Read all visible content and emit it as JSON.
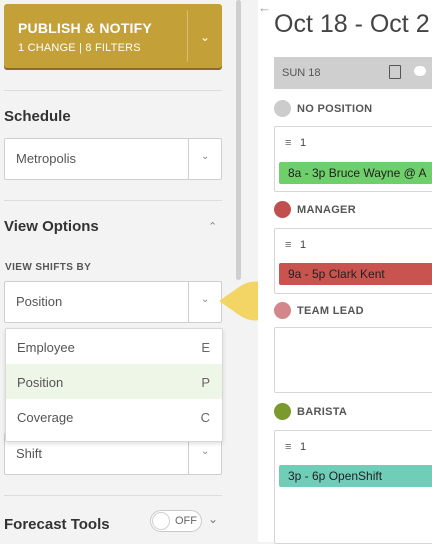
{
  "publish": {
    "title": "PUBLISH & NOTIFY",
    "subtitle": "1 CHANGE | 8 FILTERS",
    "chevron_icon": "chevron-down-icon"
  },
  "schedule": {
    "title": "Schedule",
    "location": "Metropolis"
  },
  "view_options": {
    "title": "View Options",
    "view_shifts_by_label": "VIEW SHIFTS BY",
    "selected": "Position",
    "menu": [
      {
        "label": "Employee",
        "key": "E"
      },
      {
        "label": "Position",
        "key": "P",
        "selected": true
      },
      {
        "label": "Coverage",
        "key": "C"
      }
    ],
    "second_select": "Shift"
  },
  "forecast": {
    "title": "Forecast Tools",
    "toggle_label": "OFF",
    "toggle_on": false
  },
  "calendar": {
    "week_title": "Oct 18 - Oct 2",
    "day_label": "SUN 18",
    "positions": [
      {
        "name": "NO POSITION",
        "color": "#cccccc",
        "count": "1",
        "shift": "8a - 3p  Bruce Wayne @ A",
        "shift_color": "#6fcf6a"
      },
      {
        "name": "MANAGER",
        "color": "#c0504d",
        "count": "1",
        "shift": "9a - 5p  Clark Kent",
        "shift_color": "#c9534f"
      },
      {
        "name": "TEAM LEAD",
        "color": "#d4878a"
      },
      {
        "name": "BARISTA",
        "color": "#7a9a2e",
        "count": "1",
        "shift": "3p - 6p  OpenShift",
        "shift_color": "#6fcdb8"
      }
    ]
  },
  "colors": {
    "accent": "#c3a038",
    "pointer": "#f2d564",
    "selected_menu": "#eef6e8"
  }
}
